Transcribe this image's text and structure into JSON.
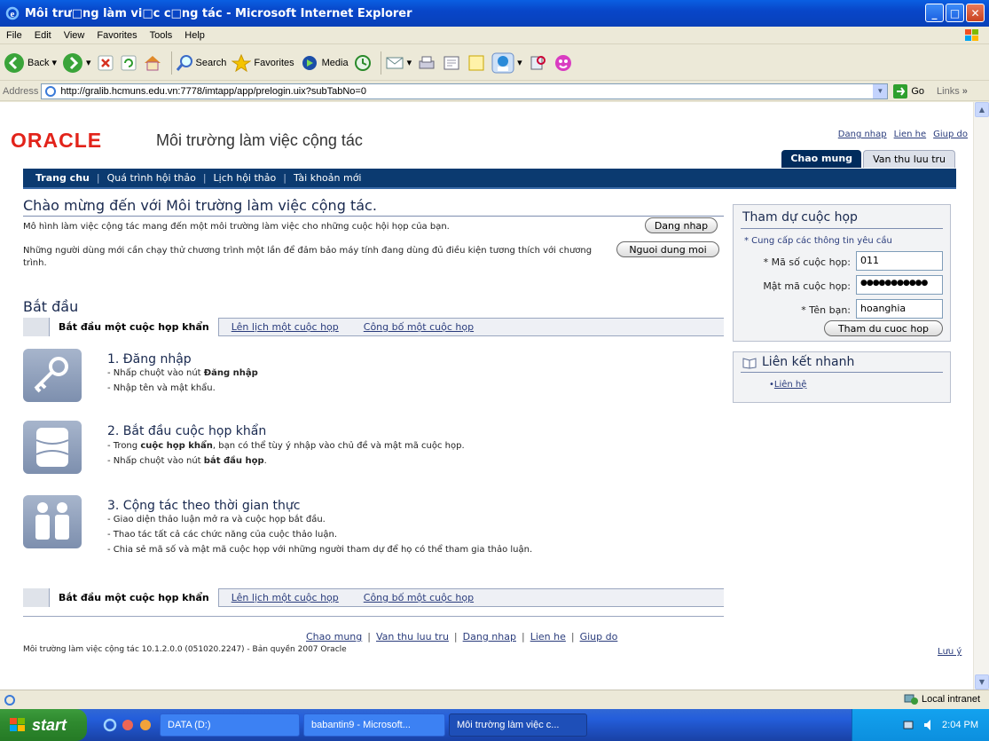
{
  "window": {
    "title": "Môi trư□ng làm vi□c c□ng tác - Microsoft Internet Explorer"
  },
  "menu": [
    "File",
    "Edit",
    "View",
    "Favorites",
    "Tools",
    "Help"
  ],
  "toolbar": {
    "back": "Back",
    "search": "Search",
    "favorites": "Favorites",
    "media": "Media"
  },
  "address": {
    "label": "Address",
    "url": "http://gralib.hcmuns.edu.vn:7778/imtapp/app/prelogin.uix?subTabNo=0",
    "go": "Go",
    "links": "Links"
  },
  "header": {
    "logo": "ORACLE",
    "app_title": "Môi trường làm việc cộng tác",
    "top_links": [
      "Dang nhap",
      "Lien he",
      "Giup do"
    ],
    "tabs": [
      {
        "label": "Chao mung",
        "active": true
      },
      {
        "label": "Van thu luu tru",
        "active": false
      }
    ]
  },
  "nav": {
    "items": [
      "Trang chu",
      "Quá trình hội thảo",
      "Lịch hội thảo",
      "Tài khoản mới"
    ]
  },
  "welcome": {
    "title": "Chào mừng đến với Môi trường làm việc cộng tác.",
    "p1": "Mô hình làm việc cộng tác mang đến một môi trường làm việc cho những cuộc hội họp của bạn.",
    "p1_button": "Dang nhap",
    "p2": "Những người dùng mới cần chạy thử chương trình một lần để đảm bảo máy tính đang dùng đủ điều kiện tương thích với chương trình.",
    "p2_button": "Nguoi dung moi"
  },
  "start": {
    "title": "Bắt đầu",
    "tabs": [
      "Bắt đầu một cuộc họp khẩn",
      "Lên lịch một cuộc họp",
      "Công bố một cuộc họp"
    ],
    "steps": [
      {
        "title": "1. Đăng nhập",
        "lines": [
          "- Nhấp chuột vào nút ",
          "Đăng nhập",
          "- Nhập tên và mật khẩu."
        ]
      },
      {
        "title": "2. Bắt đầu cuộc họp khẩn",
        "l1a": "- Trong ",
        "l1b": "cuộc họp khẩn",
        "l1c": ", bạn có thể tùy ý nhập vào chủ đề và mật mã cuộc họp.",
        "l2a": "- Nhấp chuột vào nút ",
        "l2b": "bắt đầu họp",
        "l2c": "."
      },
      {
        "title": "3. Cộng tác theo thời gian thực",
        "lines": [
          "- Giao diện thảo luận mở ra và cuộc họp bắt đầu.",
          "- Thao tác tất cả các chức năng của cuộc thảo luận.",
          "- Chia sẻ mã số và mật mã cuộc họp với những người tham dự để họ có thể tham gia thảo luận."
        ]
      }
    ]
  },
  "join": {
    "title": "Tham dự cuộc họp",
    "required_note": "* Cung cấp các thông tin yêu cầu",
    "fields": [
      {
        "label": "* Mã số cuộc họp:",
        "value": "011"
      },
      {
        "label": "Mật mã cuộc họp:",
        "value": "●●●●●●●●●●●"
      },
      {
        "label": "* Tên bạn:",
        "value": "hoanghia"
      }
    ],
    "button": "Tham du cuoc hop"
  },
  "quicklinks": {
    "title": "Liên kết nhanh",
    "items": [
      "Liên hệ"
    ]
  },
  "footer": {
    "links": [
      "Chao mung",
      "Van thu luu tru",
      "Dang nhap",
      "Lien he",
      "Giup do"
    ],
    "copyright": "Môi trường làm việc cộng tác 10.1.2.0.0 (051020.2247) - Bản quyền 2007 Oracle",
    "note": "Lưu ý"
  },
  "statusbar": {
    "zone": "Local intranet"
  },
  "taskbar": {
    "start": "start",
    "items": [
      {
        "label": "DATA (D:)",
        "active": false
      },
      {
        "label": "babantin9 - Microsoft...",
        "active": false
      },
      {
        "label": "Môi trường làm việc c...",
        "active": true
      }
    ],
    "clock": "2:04 PM"
  },
  "colors": {
    "navy": "#0b3a70",
    "oracle_red": "#e2231a",
    "xp_blue": "#0846c9",
    "link": "#2a3c7c"
  }
}
